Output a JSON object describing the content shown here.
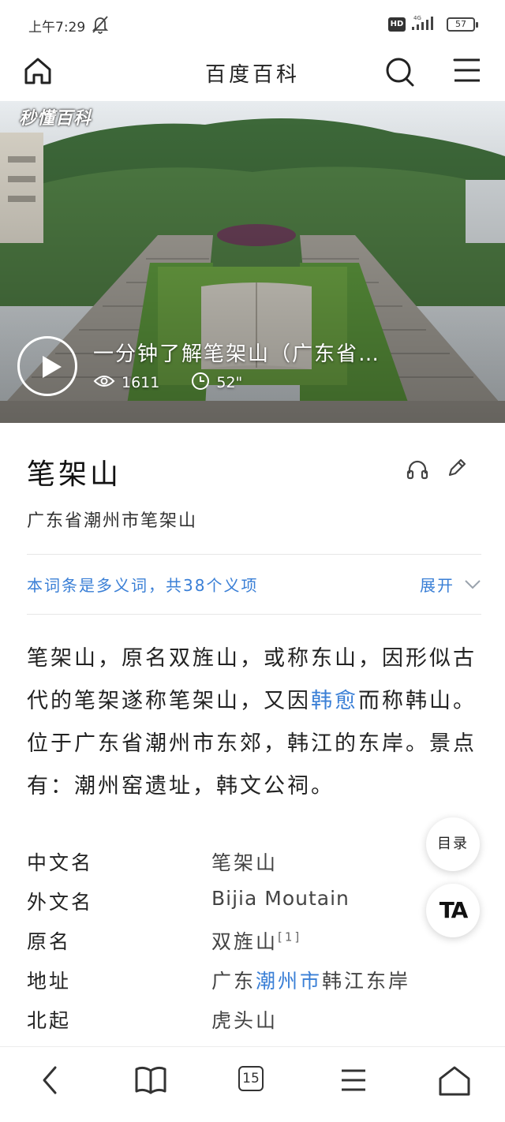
{
  "status_bar": {
    "time": "上午7:29",
    "network": "HD",
    "signal_label": "4G",
    "battery": "57"
  },
  "header": {
    "title": "百度百科"
  },
  "video": {
    "watermark": "秒懂百科",
    "title": "一分钟了解笔架山（广东省…",
    "views": "1611",
    "duration": "52\""
  },
  "article": {
    "title": "笔架山",
    "subtitle": "广东省潮州市笔架山",
    "polysemy": {
      "text": "本词条是多义词，共38个义项",
      "expand_label": "展开"
    },
    "summary": {
      "part1": "笔架山，原名双旌山，或称东山，因形似古代的笔架遂称笔架山，又因",
      "link": "韩愈",
      "part2": "而称韩山。位于广东省潮州市东郊，韩江的东岸。景点有：潮州窑遗址，韩文公祠。"
    },
    "infobox": {
      "chinese_name_key": "中文名",
      "chinese_name_val": "笔架山",
      "foreign_name_key": "外文名",
      "foreign_name_val": "Bijia Moutain",
      "original_name_key": "原名",
      "original_name_val": "双旌山",
      "original_name_ref": "[1]",
      "address_key": "地址",
      "address_prefix": "广东",
      "address_link": "潮州市",
      "address_suffix": "韩江东岸",
      "north_key": "北起",
      "north_val": "虎头山"
    }
  },
  "floating": {
    "toc_label": "目录",
    "font_label": "TA"
  },
  "bottom_bar": {
    "tab_count": "15"
  },
  "colors": {
    "link": "#3a7fd6",
    "text": "#222222"
  }
}
